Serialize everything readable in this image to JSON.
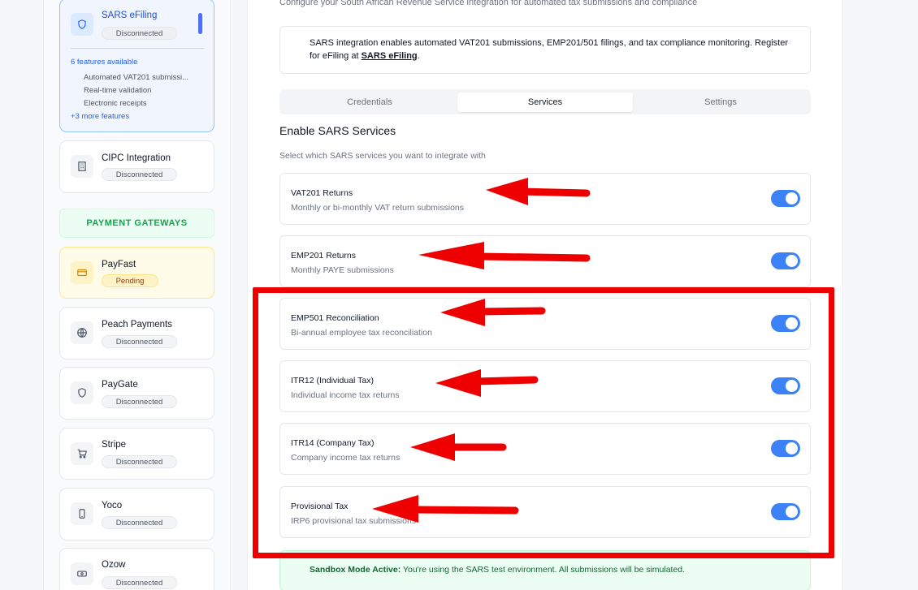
{
  "sidebar": {
    "sars": {
      "name": "SARS eFiling",
      "status": "Disconnected",
      "features_count": "6 features available",
      "features": [
        "Automated VAT201 submissi...",
        "Real-time validation",
        "Electronic receipts"
      ],
      "more": "+3 more features"
    },
    "cipc": {
      "name": "CIPC Integration",
      "status": "Disconnected"
    },
    "payment_header": "PAYMENT GATEWAYS",
    "gateways": [
      {
        "name": "PayFast",
        "status": "Pending",
        "icon": "credit-card-icon"
      },
      {
        "name": "Peach Payments",
        "status": "Disconnected",
        "icon": "globe-icon"
      },
      {
        "name": "PayGate",
        "status": "Disconnected",
        "icon": "shield-icon"
      },
      {
        "name": "Stripe",
        "status": "Disconnected",
        "icon": "cart-icon"
      },
      {
        "name": "Yoco",
        "status": "Disconnected",
        "icon": "phone-icon"
      },
      {
        "name": "Ozow",
        "status": "Disconnected",
        "icon": "banknote-icon"
      }
    ]
  },
  "main": {
    "description": "Configure your South African Revenue Service integration for automated tax submissions and compliance",
    "info": {
      "text": "SARS integration enables automated VAT201 submissions, EMP201/501 filings, and tax compliance monitoring. Register for eFiling at ",
      "link": "SARS eFiling",
      "suffix": "."
    },
    "tabs": [
      "Credentials",
      "Services",
      "Settings"
    ],
    "active_tab": "Services",
    "section_title": "Enable SARS Services",
    "section_subtitle": "Select which SARS services you want to integrate with",
    "services": [
      {
        "title": "VAT201 Returns",
        "desc": "Monthly or bi-monthly VAT return submissions",
        "enabled": true
      },
      {
        "title": "EMP201 Returns",
        "desc": "Monthly PAYE submissions",
        "enabled": true
      },
      {
        "title": "EMP501 Reconciliation",
        "desc": "Bi-annual employee tax reconciliation",
        "enabled": true
      },
      {
        "title": "ITR12 (Individual Tax)",
        "desc": "Individual income tax returns",
        "enabled": true
      },
      {
        "title": "ITR14 (Company Tax)",
        "desc": "Company income tax returns",
        "enabled": true
      },
      {
        "title": "Provisional Tax",
        "desc": "IRP6 provisional tax submissions",
        "enabled": true
      }
    ],
    "sandbox": {
      "label": "Sandbox Mode Active:",
      "text": " You're using the SARS test environment. All submissions will be simulated."
    }
  },
  "colors": {
    "accent": "#3b82f6",
    "annotation": "#ee0000",
    "gateway_header": "#16a34a"
  }
}
